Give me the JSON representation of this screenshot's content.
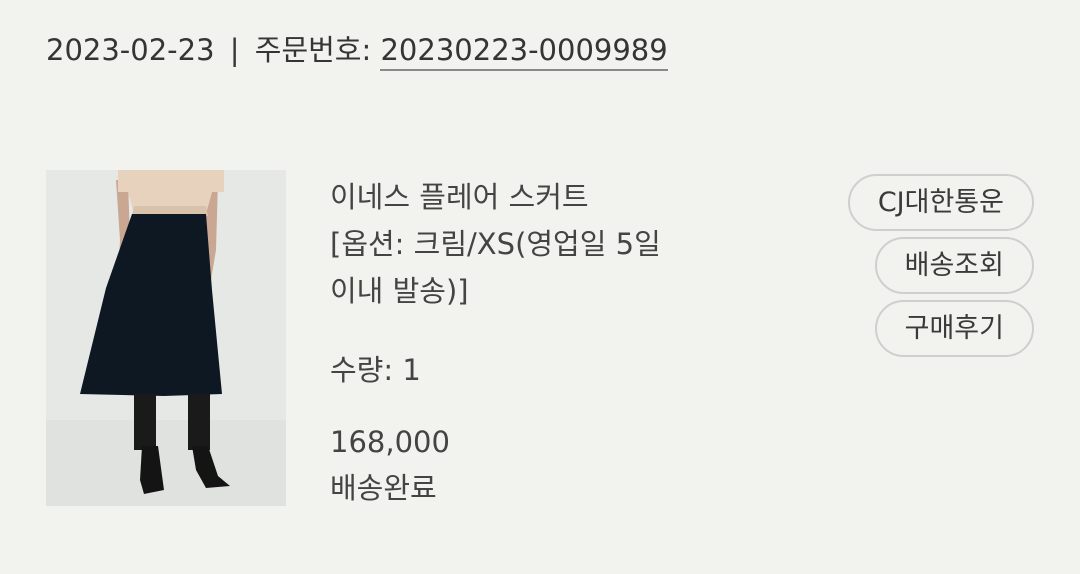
{
  "order": {
    "date": "2023-02-23",
    "separator": "|",
    "number_label": "주문번호:",
    "number": "20230223-0009989"
  },
  "product": {
    "name_line1": "이네스 플레어 스커트",
    "name_line2": "[옵션: 크림/XS(영업일 5일",
    "name_line3": "이내 발송)]",
    "quantity": "수량: 1",
    "price": "168,000",
    "status": "배송완료"
  },
  "actions": {
    "courier": "CJ대한통운",
    "track": "배송조회",
    "review": "구매후기"
  },
  "colors": {
    "background": "#f2f3ee",
    "text": "#353535",
    "button_border": "#cfcfcf"
  }
}
